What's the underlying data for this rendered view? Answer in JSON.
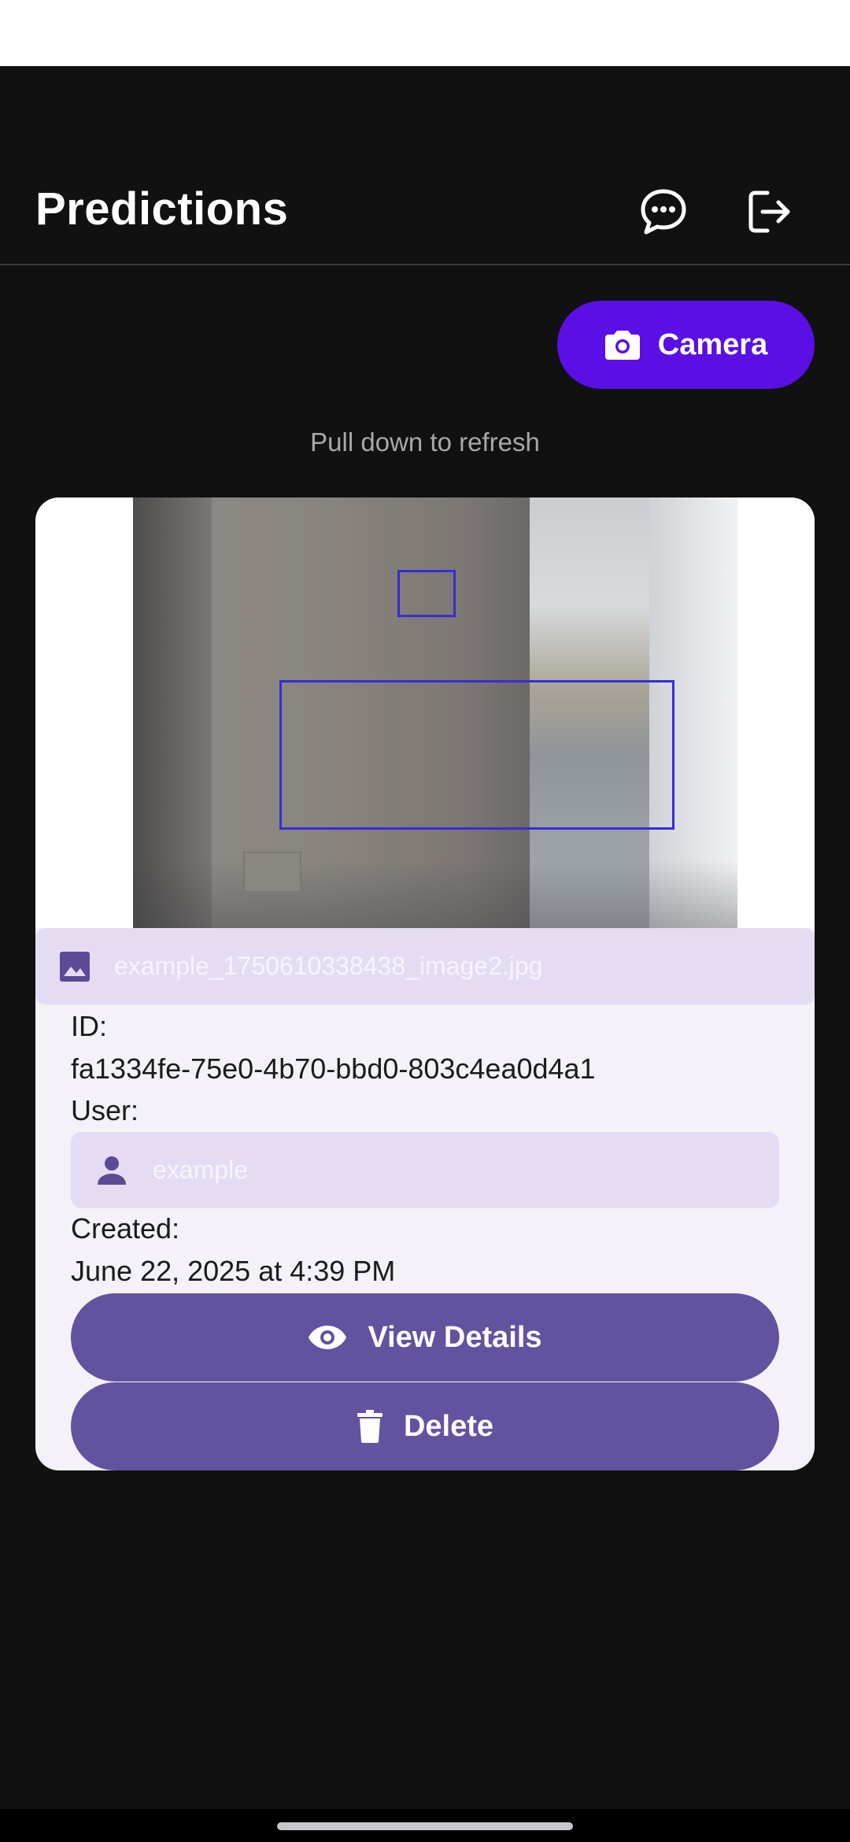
{
  "app_bar": {
    "title": "Predictions",
    "icons": [
      "chat-bubble-icon",
      "logout-icon"
    ]
  },
  "camera_button": {
    "label": "Camera",
    "icon": "camera-icon",
    "color": "#5a0fe4"
  },
  "refresh_hint": "Pull down to refresh",
  "prediction_card": {
    "image_alt": "detection image",
    "file_name": "example_1750610338438_image2.jpg",
    "file_icon": "image-icon",
    "id_label": "ID:",
    "id_value": "fa1334fe-75e0-4b70-bbd0-803c4ea0d4a1",
    "user_label": "User:",
    "user_value": "example",
    "user_icon": "person-icon",
    "created_label": "Created:",
    "created_value": "June 22, 2025 at 4:39 PM",
    "view_details_label": "View Details",
    "view_details_icon": "eye-icon",
    "delete_label": "Delete",
    "delete_icon": "trash-icon",
    "button_color": "#63529e",
    "chip_color": "#e5dcf4"
  }
}
